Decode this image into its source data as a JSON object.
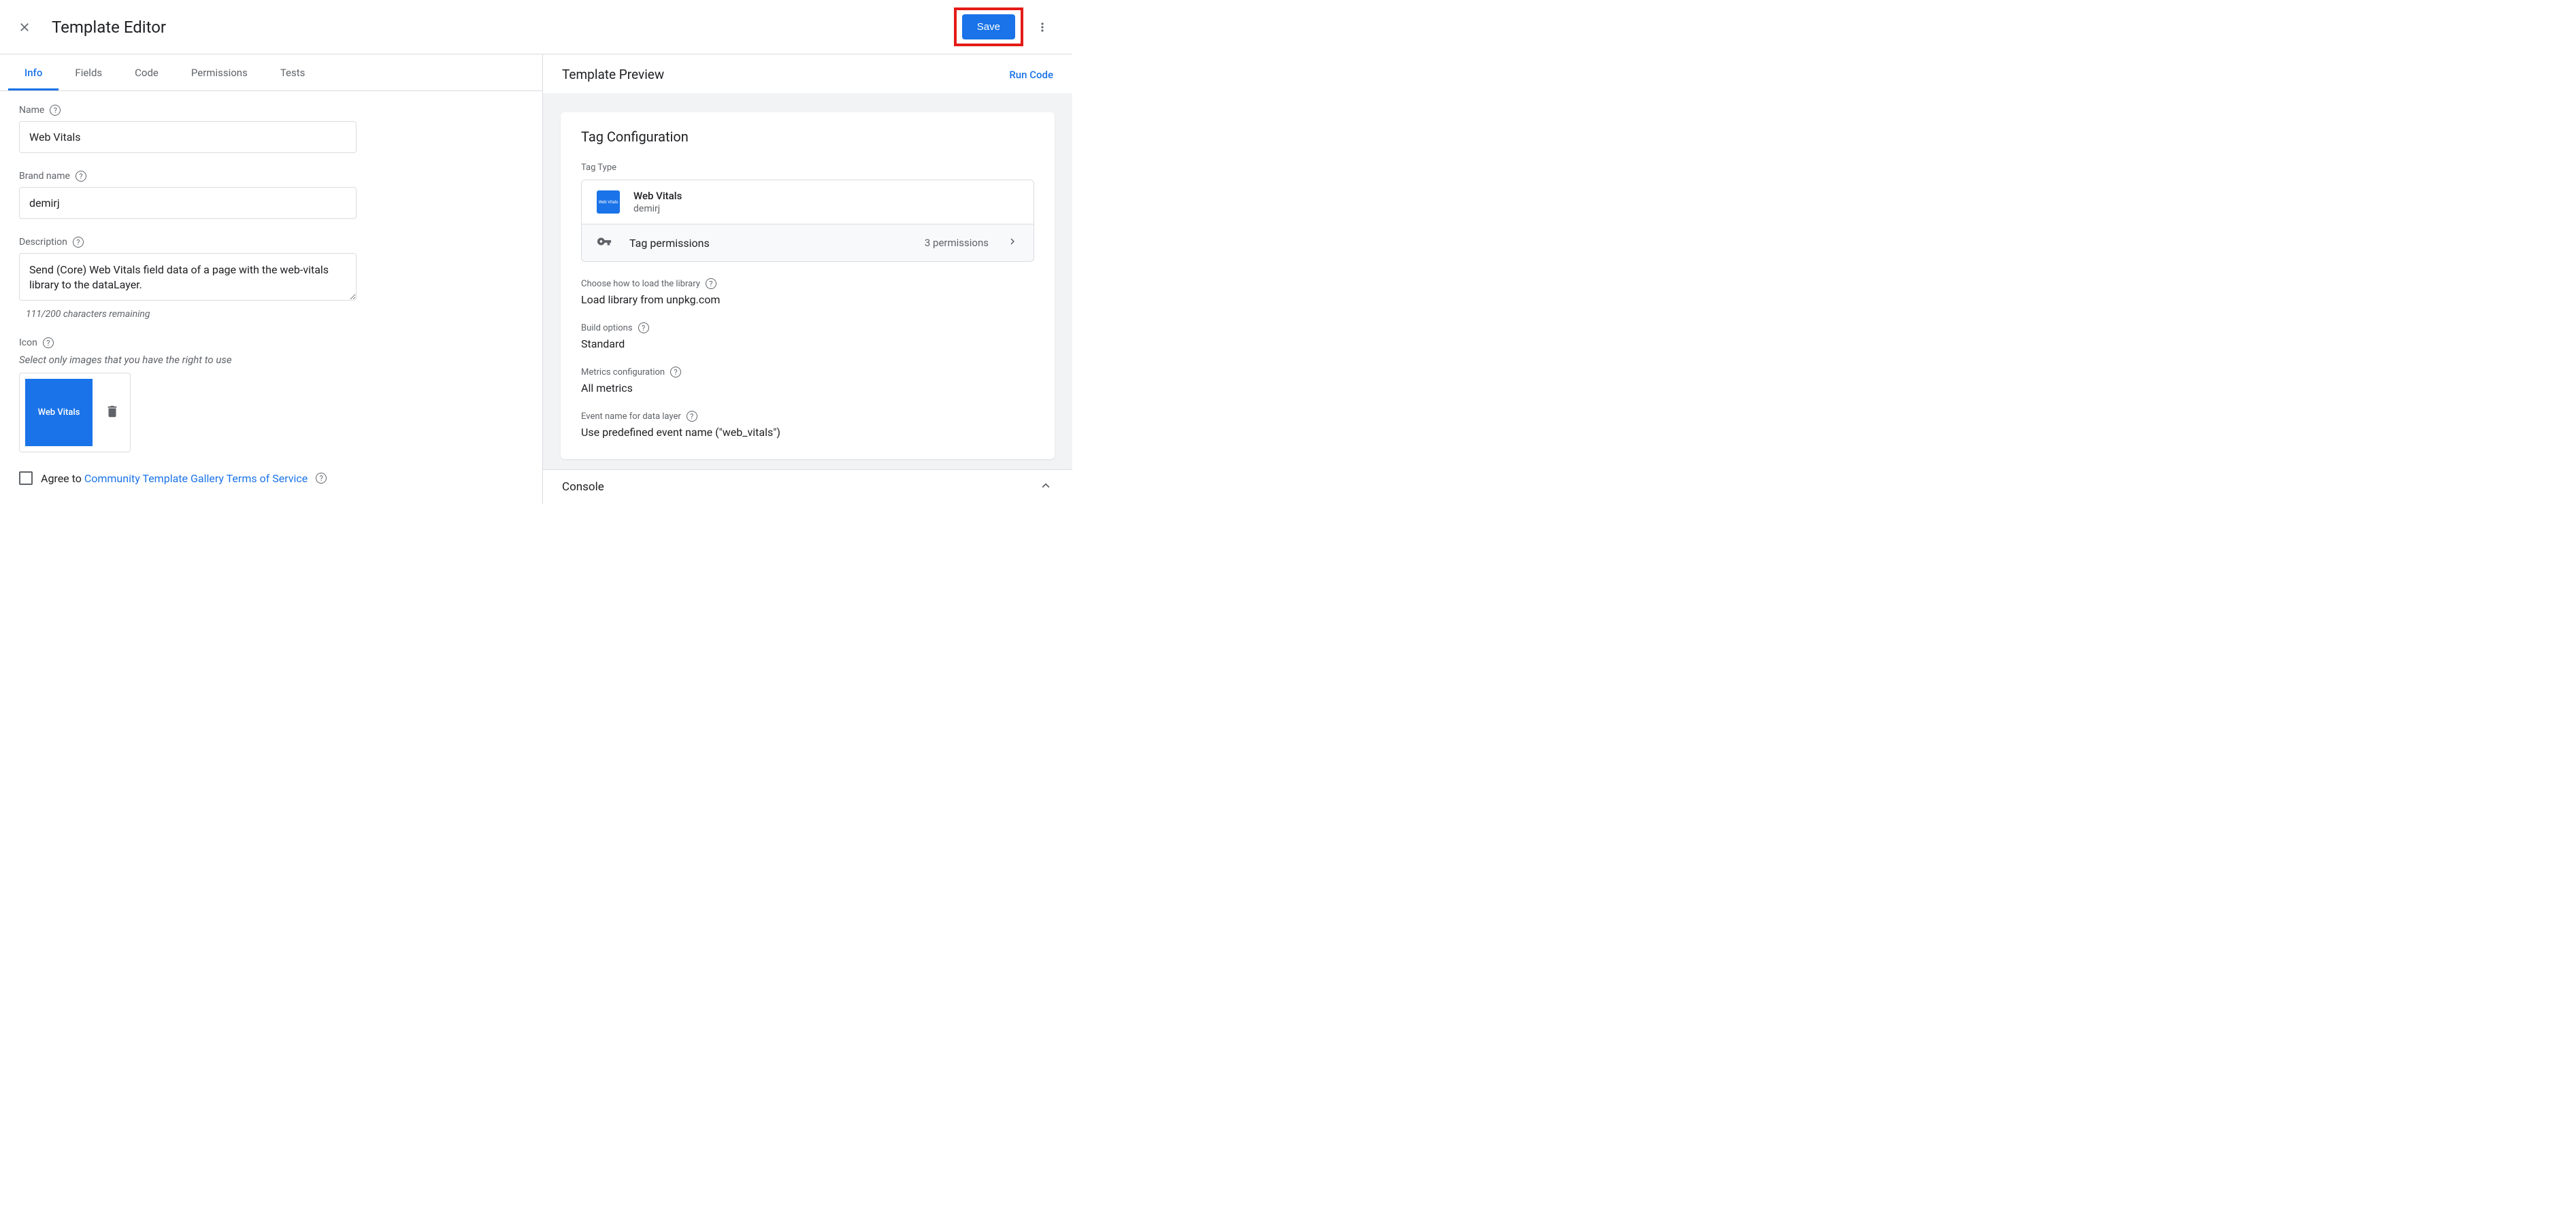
{
  "header": {
    "title": "Template Editor",
    "save_label": "Save"
  },
  "tabs": [
    "Info",
    "Fields",
    "Code",
    "Permissions",
    "Tests"
  ],
  "form": {
    "name_label": "Name",
    "name_value": "Web Vitals",
    "brand_label": "Brand name",
    "brand_value": "demirj",
    "desc_label": "Description",
    "desc_value": "Send (Core) Web Vitals field data of a page with the web-vitals library to the dataLayer.",
    "char_count": "111/200 characters remaining",
    "icon_label": "Icon",
    "icon_hint": "Select only images that you have the right to use",
    "icon_thumb_text": "Web Vitals",
    "agree_prefix": "Agree to ",
    "agree_link": "Community Template Gallery Terms of Service"
  },
  "preview": {
    "title": "Template Preview",
    "run_code": "Run Code",
    "card_title": "Tag Configuration",
    "tag_type_label": "Tag Type",
    "type_name": "Web Vitals",
    "type_brand": "demirj",
    "type_icon_text": "Web Vitals",
    "perm_label": "Tag permissions",
    "perm_count": "3 permissions",
    "configs": [
      {
        "label": "Choose how to load the library",
        "value": "Load library from unpkg.com",
        "help": true
      },
      {
        "label": "Build options",
        "value": "Standard",
        "help": true
      },
      {
        "label": "Metrics configuration",
        "value": "All metrics",
        "help": true
      },
      {
        "label": "Event name for data layer",
        "value": "Use predefined event name (\"web_vitals\")",
        "help": true
      }
    ]
  },
  "console": {
    "title": "Console"
  }
}
